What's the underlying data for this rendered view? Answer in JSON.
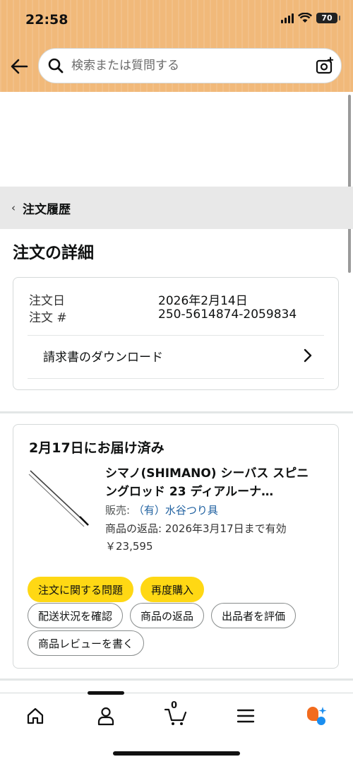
{
  "status_bar": {
    "time": "22:58",
    "battery": "70"
  },
  "search": {
    "placeholder": "検索または質問する"
  },
  "breadcrumb": {
    "label": "注文履歴"
  },
  "page_title": "注文の詳細",
  "order_info": {
    "date_label": "注文日",
    "date_value": "2026年2月14日",
    "number_label": "注文 #",
    "number_value": "250-5614874-2059834",
    "invoice_link": "請求書のダウンロード"
  },
  "shipment": {
    "status": "2月17日にお届け済み",
    "product_title": "シマノ(SHIMANO) シーバス スピニングロッド 23 ディアルーナ…",
    "seller_label": "販売:",
    "seller_name": "（有）水谷つり具",
    "return_info": "商品の返品: 2026年3月17日まで有効",
    "price": "￥23,595",
    "buttons": {
      "problem": "注文に関する問題",
      "rebuy": "再度購入",
      "track": "配送状況を確認",
      "return": "商品の返品",
      "rate_seller": "出品者を評価",
      "review": "商品レビューを書く"
    }
  },
  "bottom_nav": {
    "cart_count": "0"
  },
  "colors": {
    "header_bg": "#f1b97a",
    "button_yellow": "#ffd814",
    "link_blue": "#2162a1"
  }
}
